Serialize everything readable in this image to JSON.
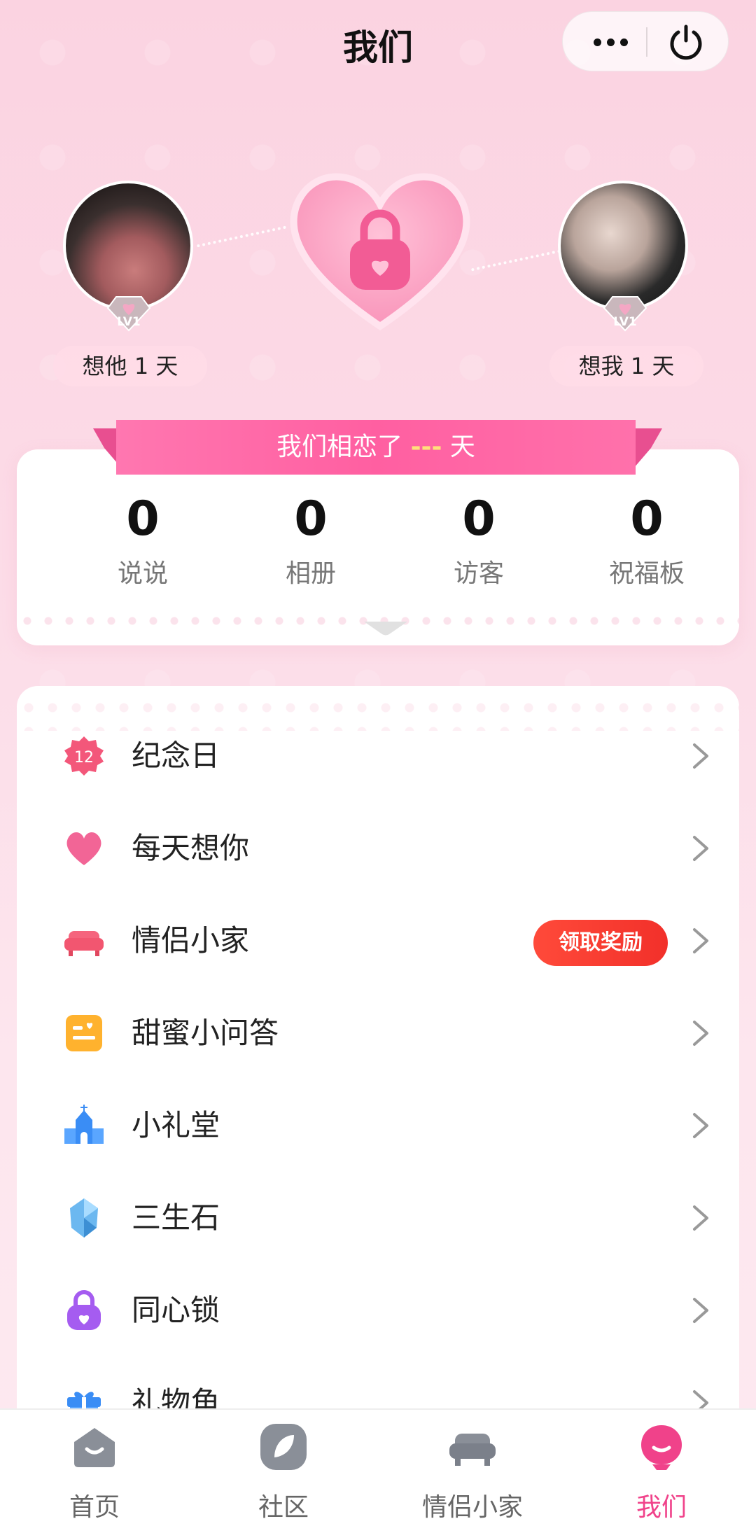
{
  "header": {
    "title": "我们"
  },
  "couple": {
    "left": {
      "level": "LV1",
      "miss_text": "想他 1 天"
    },
    "right": {
      "level": "LV1",
      "miss_text": "想我 1 天"
    }
  },
  "together": {
    "prefix": "我们相恋了",
    "days": "---",
    "suffix": "天"
  },
  "stats": [
    {
      "value": "0",
      "label": "说说"
    },
    {
      "value": "0",
      "label": "相册"
    },
    {
      "value": "0",
      "label": "访客"
    },
    {
      "value": "0",
      "label": "祝福板"
    }
  ],
  "menu": [
    {
      "label": "纪念日",
      "icon": "calendar-12-icon",
      "icon_text": "12"
    },
    {
      "label": "每天想你",
      "icon": "heart-icon"
    },
    {
      "label": "情侣小家",
      "icon": "sofa-icon",
      "badge": "领取奖励"
    },
    {
      "label": "甜蜜小问答",
      "icon": "quiz-card-icon"
    },
    {
      "label": "小礼堂",
      "icon": "chapel-icon"
    },
    {
      "label": "三生石",
      "icon": "crystal-stone-icon"
    },
    {
      "label": "同心锁",
      "icon": "heart-lock-icon"
    },
    {
      "label": "礼物角",
      "icon": "gift-icon"
    }
  ],
  "tabs": [
    {
      "label": "首页",
      "icon": "home-icon",
      "active": false
    },
    {
      "label": "社区",
      "icon": "community-leaf-icon",
      "active": false
    },
    {
      "label": "情侣小家",
      "icon": "sofa-icon",
      "active": false
    },
    {
      "label": "我们",
      "icon": "us-icon",
      "active": true
    }
  ],
  "colors": {
    "accent": "#f0428a",
    "ribbon": "#ff5fa1",
    "reward": "#f2302a",
    "background": "#fcdbe7"
  }
}
